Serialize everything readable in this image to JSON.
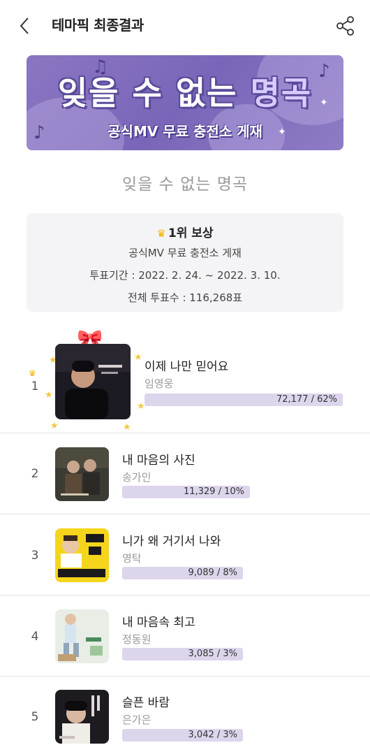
{
  "header": {
    "title": "테마픽 최종결과",
    "back_icon": "chevron-left-icon",
    "share_icon": "share-icon"
  },
  "banner": {
    "title_part1": "잊을 수 없는 ",
    "title_part2": "명곡",
    "subtitle": "공식MV 무료 충전소 게재"
  },
  "section_title": "잊을 수 없는 명곡",
  "reward": {
    "heading": "1위 보상",
    "benefit": "공식MV 무료 충전소 게재",
    "period": "투표기간 : 2022. 2. 24. ~ 2022. 3. 10.",
    "total_votes": "전체 투표수 : 116,268표"
  },
  "rankings": [
    {
      "rank": "1",
      "title": "이제 나만 믿어요",
      "artist": "임영웅",
      "votes_label": "72,177 / 62%",
      "percent": 62
    },
    {
      "rank": "2",
      "title": "내 마음의 사진",
      "artist": "송가인",
      "votes_label": "11,329 / 10%",
      "percent": 10
    },
    {
      "rank": "3",
      "title": "니가 왜 거기서 나와",
      "artist": "영탁",
      "votes_label": "9,089 / 8%",
      "percent": 8
    },
    {
      "rank": "4",
      "title": "내 마음속 최고",
      "artist": "정동원",
      "votes_label": "3,085 / 3%",
      "percent": 3
    },
    {
      "rank": "5",
      "title": "슬픈 바람",
      "artist": "은가은",
      "votes_label": "3,042 / 3%",
      "percent": 3
    }
  ],
  "colors": {
    "bar_fill": "#ddd5ec",
    "banner": "#8a76c2",
    "crown": "#f0b400"
  }
}
